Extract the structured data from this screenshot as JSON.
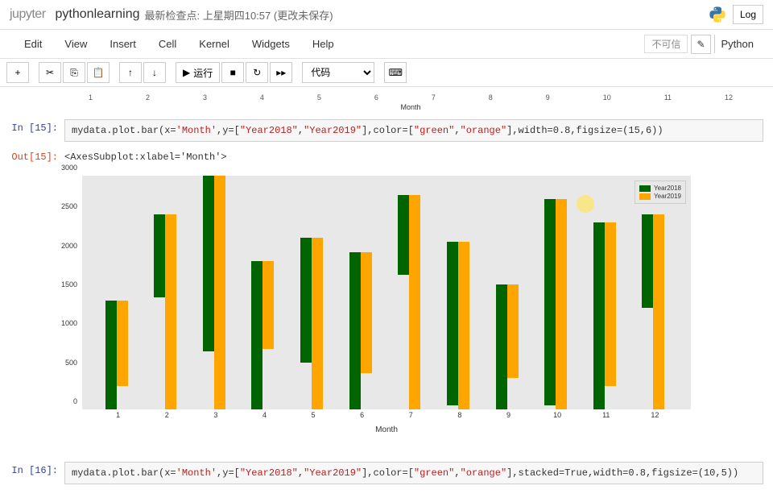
{
  "header": {
    "logo": "jupyter",
    "notebook_name": "pythonlearning",
    "checkpoint": "最新检查点: 上星期四10:57    (更改未保存)",
    "login": "Log"
  },
  "menubar": {
    "items": [
      "Edit",
      "View",
      "Insert",
      "Cell",
      "Kernel",
      "Widgets",
      "Help"
    ],
    "trust": "不可信",
    "kernel": "Python"
  },
  "toolbar": {
    "run_label": "运行",
    "cell_type": "代码"
  },
  "cells": {
    "mini_xlabel": "Month",
    "in15_prompt": "In  [15]:",
    "in15_code_pre": "mydata.plot.bar(x=",
    "in15_s1": "'Month'",
    "in15_m1": ",y=[",
    "in15_s2": "\"Year2018\"",
    "in15_m2": ",",
    "in15_s3": "\"Year2019\"",
    "in15_m3": "],color=[",
    "in15_s4": "\"green\"",
    "in15_m4": ",",
    "in15_s5": "\"orange\"",
    "in15_m5": "],width=0.8,figsize=(15,6))",
    "out15_prompt": "Out[15]:",
    "out15_text": "<AxesSubplot:xlabel='Month'>",
    "in16_prompt": "In  [16]:",
    "in16_code_pre": "mydata.plot.bar(x=",
    "in16_s1": "'Month'",
    "in16_m1": ",y=[",
    "in16_s2": "\"Year2018\"",
    "in16_m2": ",",
    "in16_s3": "\"Year2019\"",
    "in16_m3": "],color=[",
    "in16_s4": "\"green\"",
    "in16_m4": ",",
    "in16_s5": "\"orange\"",
    "in16_m5": "],stacked=True,width=0.8,figsize=(10,5))"
  },
  "chart_data": {
    "type": "bar",
    "title": "",
    "xlabel": "Month",
    "ylabel": "",
    "ylim": [
      0,
      3000
    ],
    "yticks": [
      0,
      500,
      1000,
      1500,
      2000,
      2500,
      3000
    ],
    "categories": [
      "1",
      "2",
      "3",
      "4",
      "5",
      "6",
      "7",
      "8",
      "9",
      "10",
      "11",
      "12"
    ],
    "series": [
      {
        "name": "Year2018",
        "color": "#006400",
        "values": [
          1400,
          1060,
          2250,
          1900,
          1600,
          2020,
          1020,
          2100,
          1600,
          2650,
          2400,
          1200
        ]
      },
      {
        "name": "Year2019",
        "color": "#FFA500",
        "values": [
          1100,
          2500,
          3000,
          1120,
          2200,
          1550,
          2750,
          2150,
          1200,
          2700,
          2100,
          2500
        ]
      }
    ],
    "legend_position": "upper right"
  }
}
